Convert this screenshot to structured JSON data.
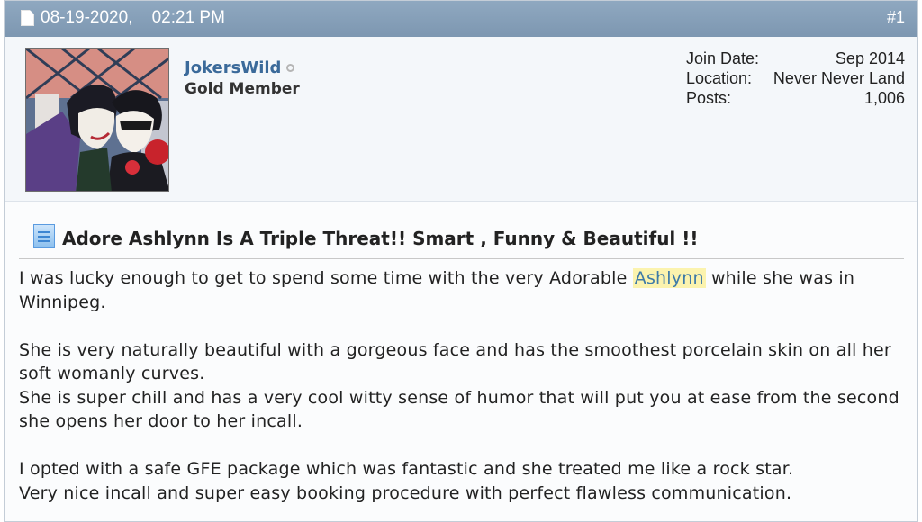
{
  "post": {
    "date": "08-19-2020,",
    "time": "02:21 PM",
    "number": "#1"
  },
  "user": {
    "name": "JokersWild",
    "title": "Gold Member",
    "info": [
      {
        "label": "Join Date:",
        "value": "Sep 2014"
      },
      {
        "label": "Location:",
        "value": "Never Never Land"
      },
      {
        "label": "Posts:",
        "value": "1,006"
      }
    ]
  },
  "message": {
    "title": "Adore Ashlynn Is A Triple Threat!! Smart , Funny & Beautiful !!",
    "p1_before": "I was lucky enough to get to spend some time with the very Adorable ",
    "p1_highlight": "Ashlynn",
    "p1_after": " while she was in Winnipeg.",
    "p2_line1": "She is very naturally beautiful with a gorgeous face and has the smoothest porcelain skin on all her soft womanly curves.",
    "p2_line2": "She is super chill and has a very cool witty sense of humor that will put you at ease from the second she opens her door to her incall.",
    "p3_line1": "I opted with a safe GFE package which was fantastic and she treated me like a rock star.",
    "p3_line2": "Very nice incall and super easy booking procedure with perfect flawless communication."
  },
  "icons": {
    "post_icon": "document-icon",
    "title_icon": "document-lines-icon",
    "status_icon": "offline-status-icon"
  },
  "colors": {
    "header_bar": "#8ba4bc",
    "username": "#3b6a9a",
    "highlight_bg": "#fbf3ae",
    "highlight_text": "#3d7aa8"
  }
}
